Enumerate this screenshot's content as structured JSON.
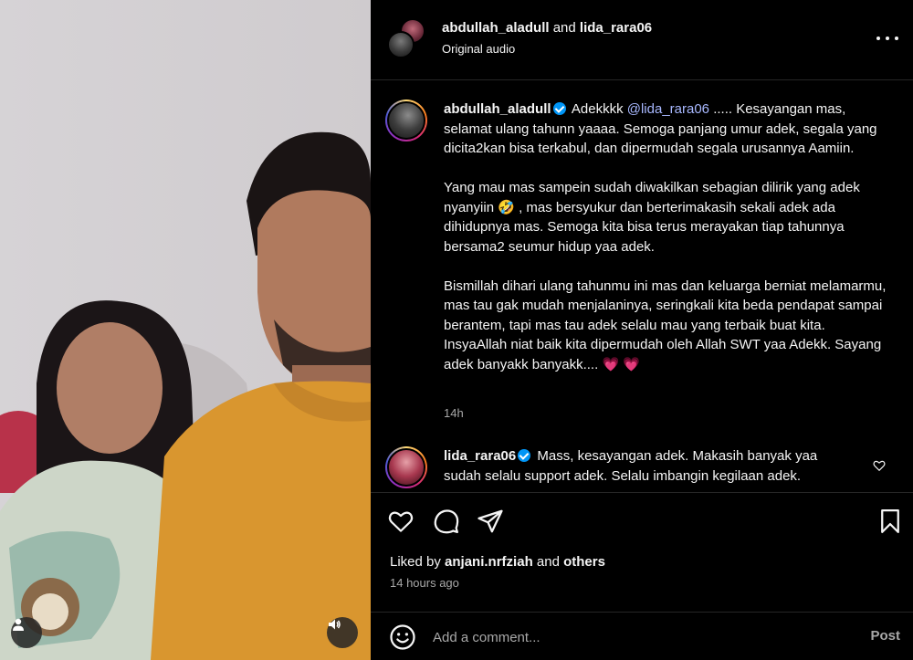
{
  "header": {
    "user1": "abdullah_aladull",
    "joiner": "and",
    "user2": "lida_rara06",
    "subtitle": "Original audio"
  },
  "caption": {
    "username": "abdullah_aladull",
    "line1_start": "Adekkkk",
    "mention": "@lida_rara06",
    "p1_rest": "..... Kesayangan mas, selamat ulang tahunn yaaaa. Semoga panjang umur adek, segala yang dicita2kan bisa terkabul, dan dipermudah segala urusannya Aamiin.",
    "p2_a": "Yang mau mas sampein sudah diwakilkan sebagian dilirik yang adek nyanyiin",
    "p2_emoji": "🤣",
    "p2_b": ", mas bersyukur dan berterimakasih sekali adek ada dihidupnya mas. Semoga kita bisa terus merayakan tiap tahunnya bersama2 seumur hidup yaa adek.",
    "p3": "Bismillah dihari ulang tahunmu ini mas dan keluarga berniat melamarmu, mas tau gak mudah menjalaninya, seringkali kita beda pendapat sampai berantem, tapi mas tau adek selalu mau yang terbaik buat kita. InsyaAllah niat baik kita dipermudah oleh Allah SWT yaa Adekk. Sayang adek banyakk banyakk....",
    "p3_emoji": "💗 💗",
    "time": "14h"
  },
  "reply": {
    "username": "lida_rara06",
    "text": "Mass, kesayangan adek. Makasih banyak yaa sudah selalu support adek. Selalu imbangin kegilaan adek."
  },
  "likes": {
    "prefix": "Liked by",
    "user": "anjani.nrfziah",
    "joiner": "and",
    "others": "others"
  },
  "posted_ago": "14 hours ago",
  "comment_box": {
    "placeholder": "Add a comment...",
    "post_label": "Post"
  },
  "icons": {
    "more": "more-horizontal-icon",
    "like": "heart-icon",
    "comment": "comment-bubble-icon",
    "share": "paper-plane-icon",
    "save": "bookmark-icon",
    "emoji": "smiley-icon",
    "tag": "user-tag-icon",
    "audio": "speaker-icon"
  },
  "colors": {
    "accent_verified": "#0095f6",
    "mention": "#a8b8ff",
    "muted": "#a8a8a8"
  }
}
